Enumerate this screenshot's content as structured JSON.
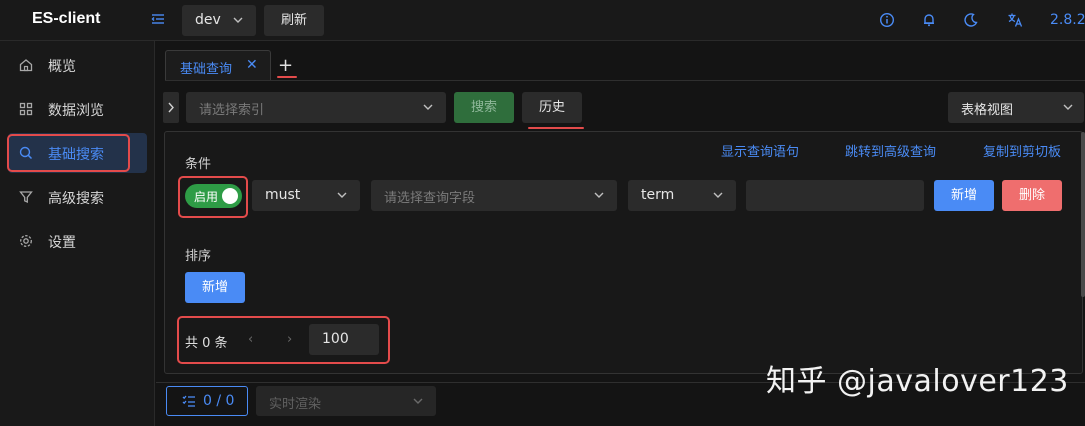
{
  "app": {
    "title": "ES-client",
    "version": "2.8.2"
  },
  "header": {
    "env_value": "dev",
    "refresh_label": "刷新"
  },
  "sidebar": {
    "items": [
      {
        "label": "概览",
        "icon": "home-icon"
      },
      {
        "label": "数据浏览",
        "icon": "grid-icon"
      },
      {
        "label": "基础搜索",
        "icon": "search-icon",
        "active": true
      },
      {
        "label": "高级搜索",
        "icon": "filter-icon"
      },
      {
        "label": "设置",
        "icon": "gear-icon"
      }
    ]
  },
  "tabs": {
    "items": [
      {
        "label": "基础查询",
        "close": "✕"
      }
    ],
    "add": "+"
  },
  "search_bar": {
    "index_placeholder": "请选择索引",
    "search_label": "搜索",
    "history_label": "历史",
    "view_value": "表格视图"
  },
  "condition": {
    "title": "条件",
    "links": [
      "显示查询语句",
      "跳转到高级查询",
      "复制到剪切板"
    ],
    "toggle_label": "启用",
    "bool_value": "must",
    "field_placeholder": "请选择查询字段",
    "op_value": "term",
    "add_label": "新增",
    "delete_label": "删除"
  },
  "sort": {
    "title": "排序",
    "add_label": "新增"
  },
  "pagination": {
    "total": "共 0 条",
    "prev": "‹",
    "next": "›",
    "page_size": "100"
  },
  "bottom": {
    "result_count": "0 / 0",
    "render_placeholder": "实时渲染"
  },
  "watermark": "知乎 @javalover123",
  "colors": {
    "accent": "#4a8bf5",
    "success": "#2e9c46",
    "danger": "#ef6e6e",
    "highlight": "#e34b4b"
  }
}
